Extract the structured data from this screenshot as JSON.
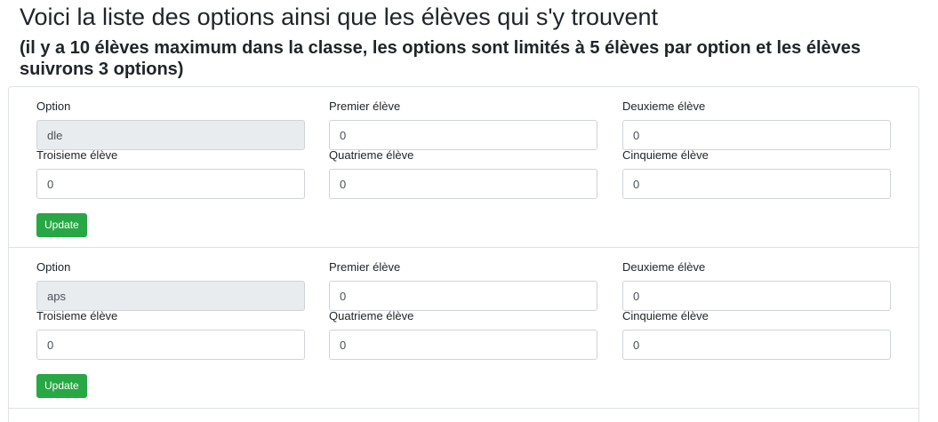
{
  "page": {
    "title": "Voici la liste des options ainsi que les élèves qui s'y trouvent",
    "subtitle": "(il y a 10 élèves maximum dans la classe, les options sont limités à 5 élèves par option et les élèves suivrons 3 options)"
  },
  "labels": {
    "option": "Option",
    "premier": "Premier élève",
    "deuxieme": "Deuxieme élève",
    "troisieme": "Troisieme élève",
    "quatrieme": "Quatrieme élève",
    "cinquieme": "Cinquieme élève",
    "update_button": "Update"
  },
  "options": [
    {
      "option": "dle",
      "premier": "0",
      "deuxieme": "0",
      "troisieme": "0",
      "quatrieme": "0",
      "cinquieme": "0"
    },
    {
      "option": "aps",
      "premier": "0",
      "deuxieme": "0",
      "troisieme": "0",
      "quatrieme": "0",
      "cinquieme": "0"
    }
  ],
  "colors": {
    "update_button": "#28a745",
    "readonly_background": "#e9ecef",
    "border": "#dee2e6"
  }
}
